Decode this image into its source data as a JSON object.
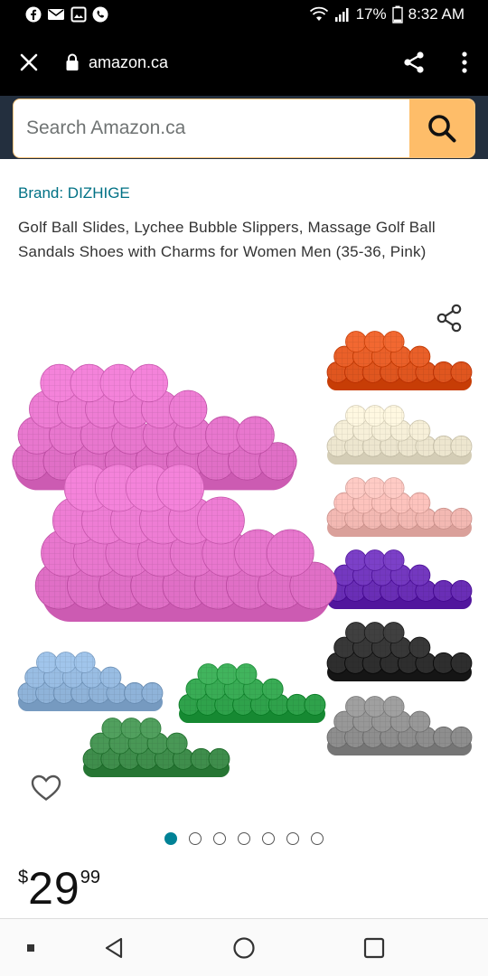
{
  "status_bar": {
    "battery": "17%",
    "time": "8:32 AM",
    "notification_icons": [
      "facebook-icon",
      "mail-icon",
      "gallery-icon",
      "phone-icon"
    ]
  },
  "browser": {
    "url": "amazon.ca",
    "icons": [
      "close-icon",
      "lock-icon",
      "share-icon",
      "overflow-menu-icon"
    ]
  },
  "search": {
    "placeholder": "Search Amazon.ca",
    "value": ""
  },
  "product": {
    "brand": "Brand: DIZHIGE",
    "title": "Golf Ball Slides, Lychee Bubble Slippers, Massage Golf Ball Sandals Shoes with Charms for Women Men (35-36, Pink)",
    "price": {
      "symbol": "$",
      "whole": "29",
      "fraction": "99"
    },
    "gallery": {
      "image_count": 7,
      "active_index": 0
    }
  },
  "colors": {
    "brand_link": "#007185",
    "search_button": "#febd69",
    "header": "#232f3e",
    "active_dot": "#008296",
    "main_slide": "#e06fc6",
    "slide_swatches": [
      "#e0561f",
      "#ede6cf",
      "#f3b9b3",
      "#6a2eb6",
      "#2e2e2e",
      "#8e8e8e",
      "#8fb3d9",
      "#2fa24b",
      "#3f8e4c"
    ]
  }
}
